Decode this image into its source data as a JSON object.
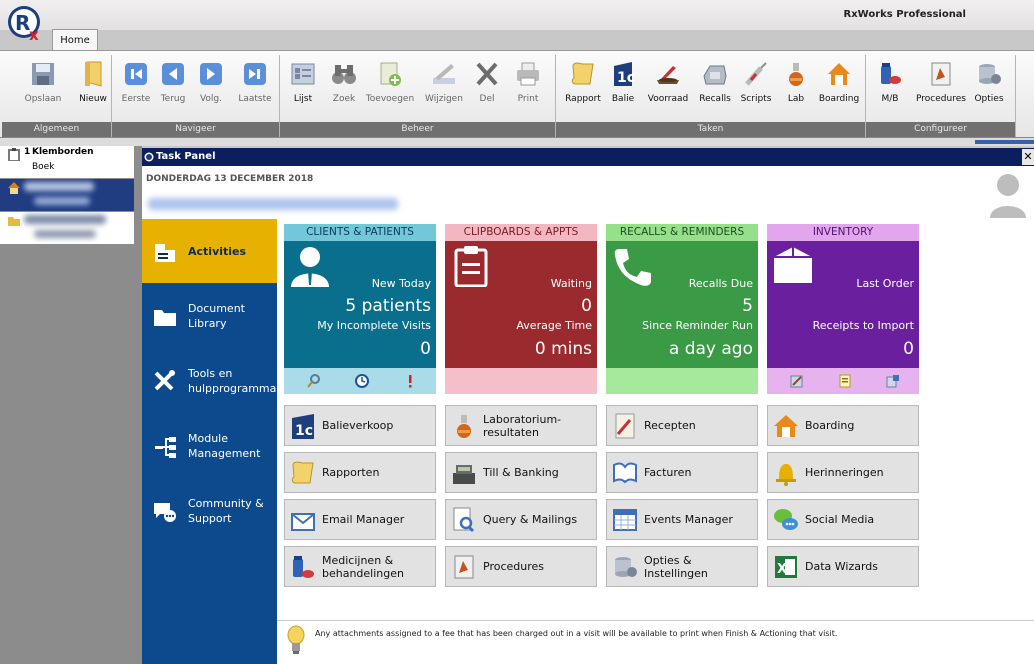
{
  "window": {
    "title": "RxWorks Professional",
    "tab": "Home"
  },
  "ribbon": {
    "groups": [
      {
        "label": "Algemeen",
        "buttons": [
          {
            "label": "Opslaan",
            "icon": "save-icon"
          },
          {
            "label": "Nieuw",
            "icon": "new-icon"
          }
        ]
      },
      {
        "label": "Navigeer",
        "buttons": [
          {
            "label": "Eerste",
            "icon": "first-icon"
          },
          {
            "label": "Terug",
            "icon": "back-icon"
          },
          {
            "label": "Volg.",
            "icon": "next-icon"
          },
          {
            "label": "Laatste",
            "icon": "last-icon"
          }
        ]
      },
      {
        "label": "Beheer",
        "buttons": [
          {
            "label": "Lijst",
            "icon": "list-icon"
          },
          {
            "label": "Zoek",
            "icon": "binoculars-icon"
          },
          {
            "label": "Toevoegen",
            "icon": "add-icon"
          },
          {
            "label": "Wijzigen",
            "icon": "edit-icon"
          },
          {
            "label": "Del",
            "icon": "delete-icon"
          },
          {
            "label": "Print",
            "icon": "print-icon"
          }
        ]
      },
      {
        "label": "Taken",
        "buttons": [
          {
            "label": "Rapport",
            "icon": "scroll-icon"
          },
          {
            "label": "Balie",
            "icon": "counter-icon"
          },
          {
            "label": "Voorraad",
            "icon": "stock-icon"
          },
          {
            "label": "Recalls",
            "icon": "phone-icon"
          },
          {
            "label": "Scripts",
            "icon": "syringe-icon"
          },
          {
            "label": "Lab",
            "icon": "lab-icon"
          },
          {
            "label": "Boarding",
            "icon": "house-icon"
          }
        ]
      },
      {
        "label": "Configureer",
        "buttons": [
          {
            "label": "M/B",
            "icon": "medicine-icon"
          },
          {
            "label": "Procedures",
            "icon": "procedures-icon"
          },
          {
            "label": "Opties",
            "icon": "options-icon"
          }
        ]
      }
    ]
  },
  "left_pane": {
    "item_number": "1",
    "item_title": "Klemborden",
    "item_sub": "Boek"
  },
  "task_panel": {
    "title": "Task Panel",
    "date": "DONDERDAG 13 DECEMBER 2018"
  },
  "sidebar": [
    {
      "label": "Activities",
      "icon": "activities-icon"
    },
    {
      "label": "Document\nLibrary",
      "icon": "folder-icon"
    },
    {
      "label": "Tools en\nhulpprogramma",
      "icon": "tools-icon"
    },
    {
      "label": "Module\nManagement",
      "icon": "module-icon"
    },
    {
      "label": "Community &\nSupport",
      "icon": "community-icon"
    }
  ],
  "tiles": [
    {
      "header": "CLIENTS & PATIENTS",
      "label1": "New Today",
      "value1": "5 patients",
      "label2": "My Incomplete Visits",
      "value2": "0",
      "color": "#0a6f8c",
      "header_bg": "#72c7d9",
      "header_fg": "#0c3a5e",
      "foot_bg": "#a9dbe8",
      "icon": "person-icon"
    },
    {
      "header": "CLIPBOARDS & APPTS",
      "label1": "Waiting",
      "value1": "0",
      "label2": "Average Time",
      "value2": "0 mins",
      "color": "#9b2a2e",
      "header_bg": "#f3b7c2",
      "header_fg": "#7a1a22",
      "foot_bg": "#f5bfca",
      "icon": "clipboard-icon"
    },
    {
      "header": "RECALLS & REMINDERS",
      "label1": "Recalls Due",
      "value1": "5",
      "label2": "Since Reminder Run",
      "value2": "a day ago",
      "color": "#3b9a45",
      "header_bg": "#96e08c",
      "header_fg": "#1d4d1f",
      "foot_bg": "#a6e89c",
      "icon": "phone-tile-icon"
    },
    {
      "header": "INVENTORY",
      "label1": "Last Order",
      "value1": "",
      "label2": "Receipts to Import",
      "value2": "0",
      "color": "#6a1f9e",
      "header_bg": "#e2a6ec",
      "header_fg": "#4a1470",
      "foot_bg": "#e6b3ee",
      "icon": "box-icon"
    }
  ],
  "shortcuts": [
    [
      "Balieverkoop",
      "Laboratorium-\nresultaten",
      "Recepten",
      "Boarding"
    ],
    [
      "Rapporten",
      "Till & Banking",
      "Facturen",
      "Herinneringen"
    ],
    [
      "Email Manager",
      "Query & Mailings",
      "Events Manager",
      "Social Media"
    ],
    [
      "Medicijnen &\nbehandelingen",
      "Procedures",
      "Opties &\nInstellingen",
      "Data Wizards"
    ]
  ],
  "tip": "Any attachments assigned to a fee that has been charged out in a visit will be available to print when Finish & Actioning that visit."
}
